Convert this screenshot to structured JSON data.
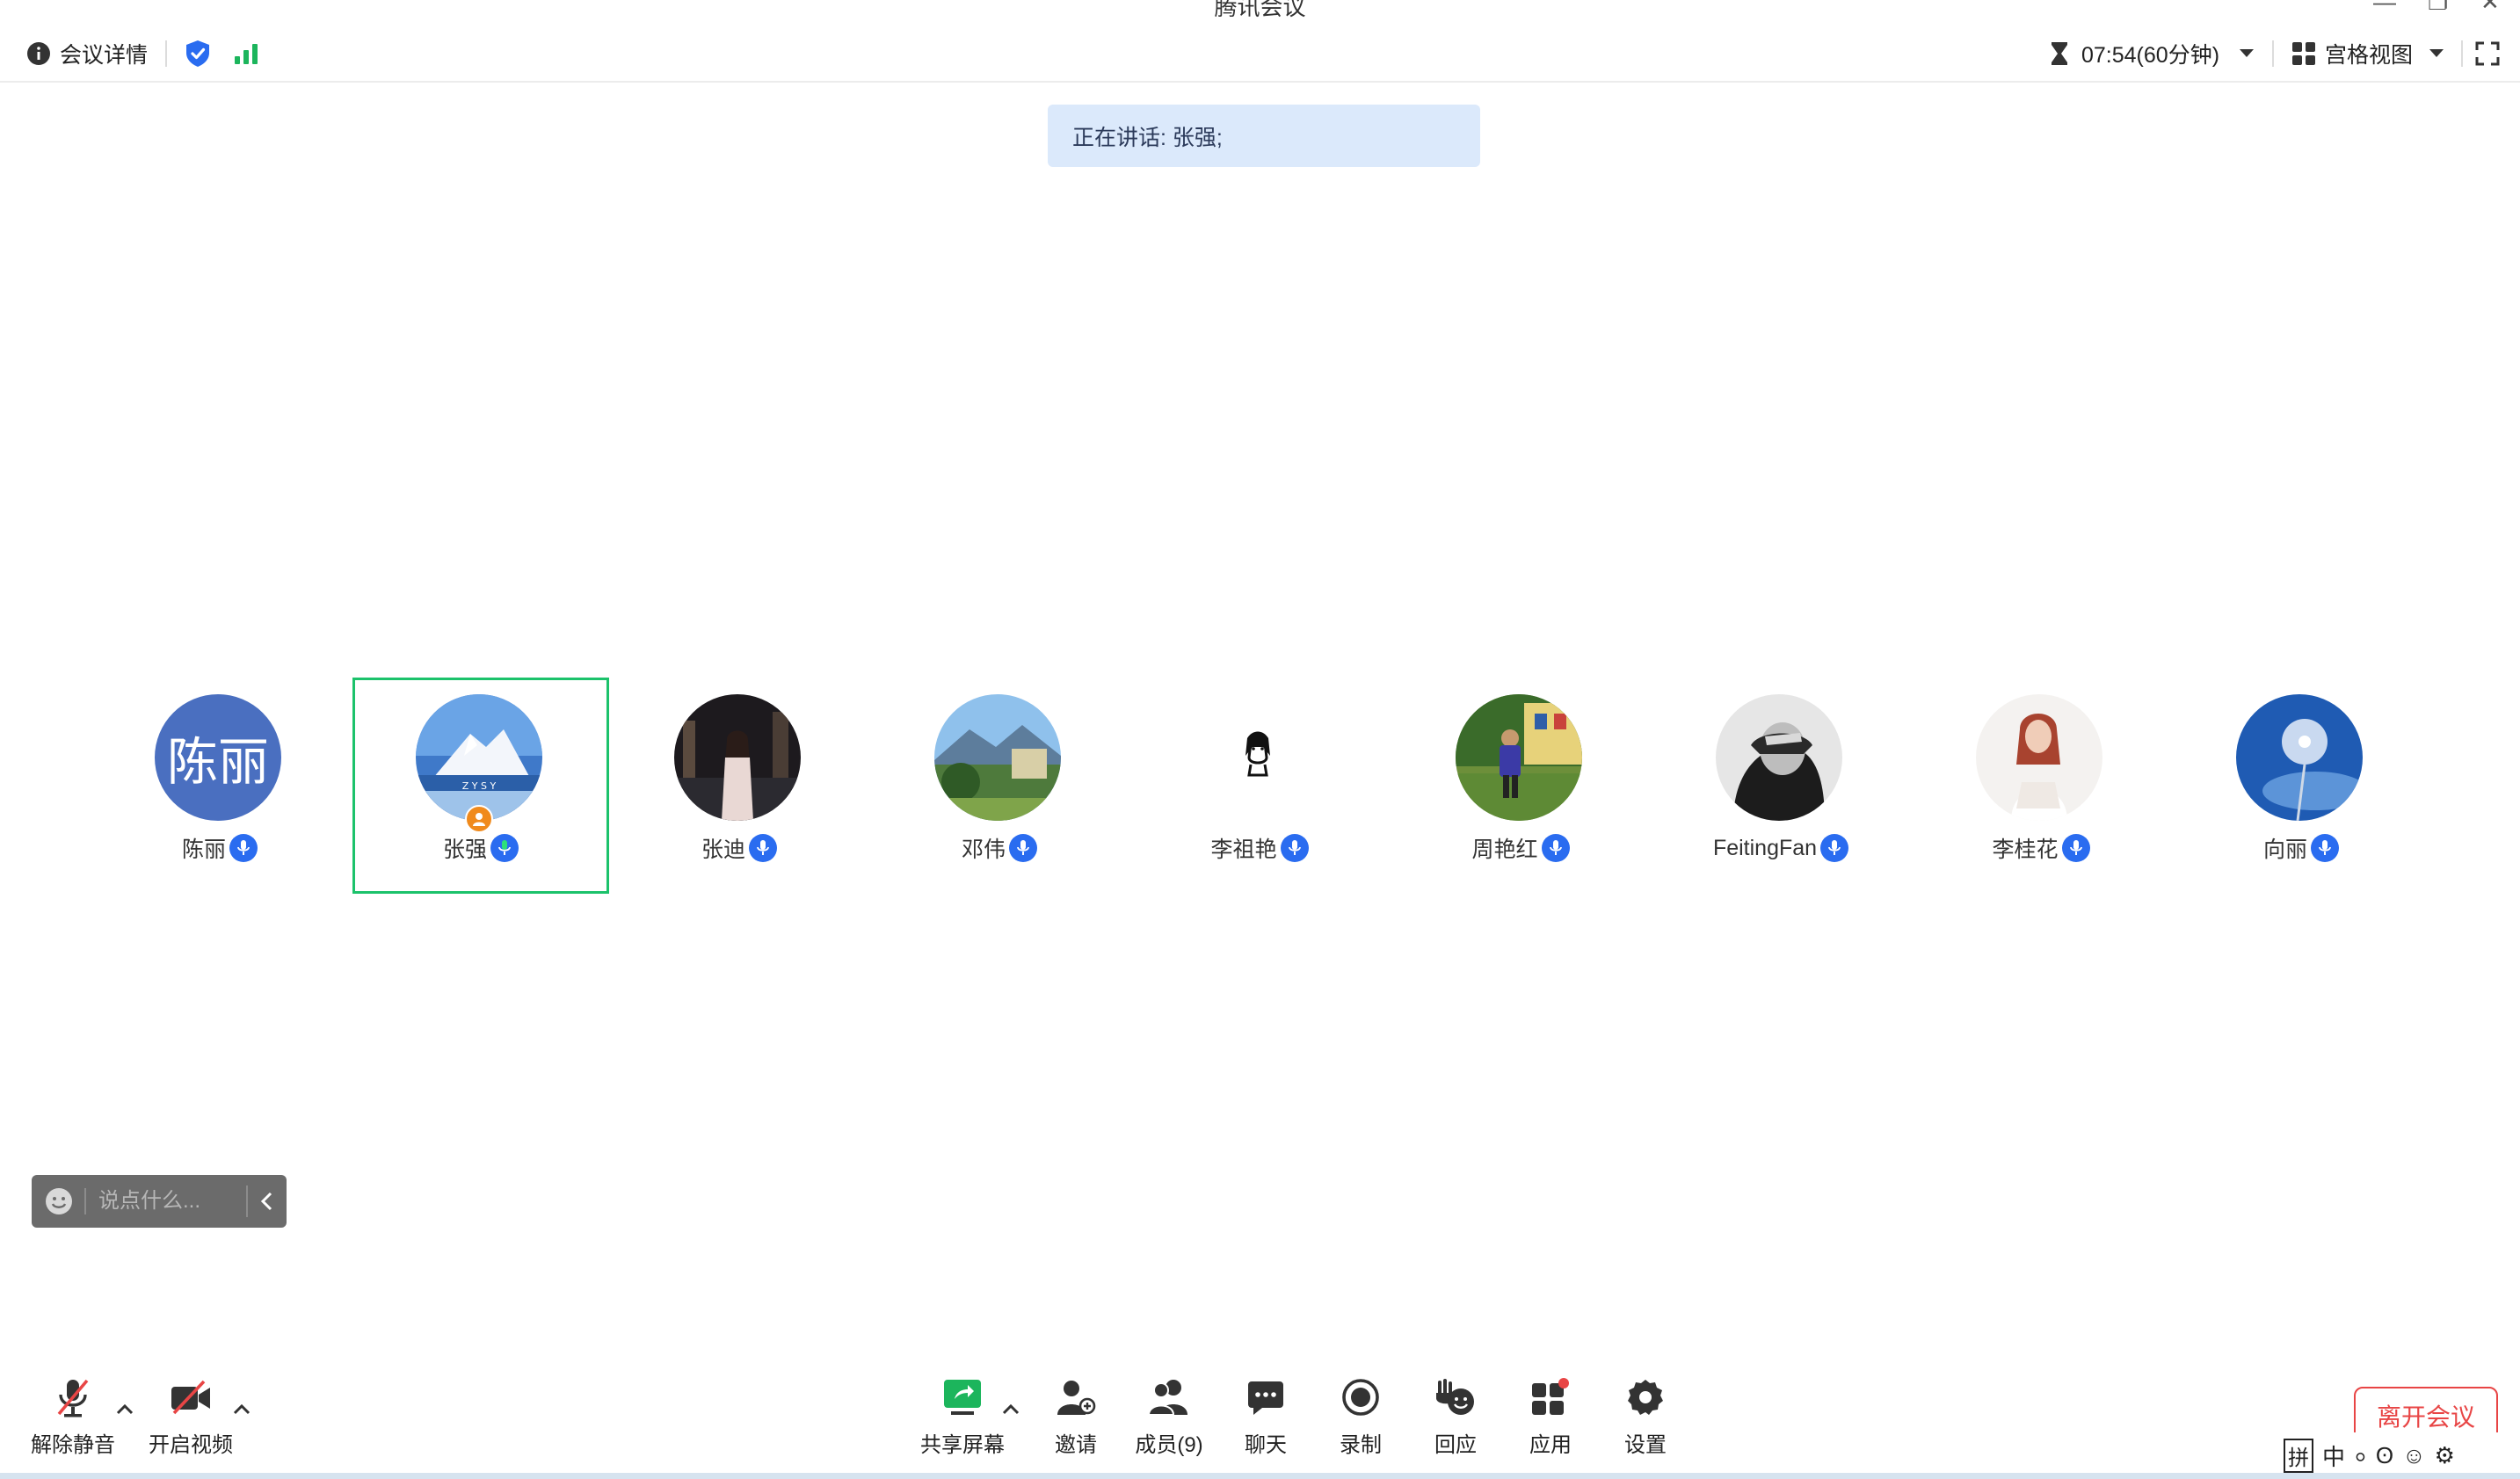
{
  "window": {
    "title": "腾讯会议",
    "controls": [
      "minimize-icon",
      "restore-icon",
      "close-icon"
    ]
  },
  "topbar": {
    "meeting_details_label": "会议详情",
    "security_icon": "shield-check-icon",
    "signal_icon": "signal-bars-icon",
    "timer": "07:54(60分钟)",
    "view_mode_label": "宫格视图",
    "fullscreen_icon": "fullscreen-icon"
  },
  "speaking": {
    "text": "正在讲话: 张强;"
  },
  "participants": [
    {
      "name": "陈丽",
      "avatar_text": "陈丽",
      "avatar_kind": "text",
      "avatar_color": "#4a6fc0"
    },
    {
      "name": "张强",
      "avatar_kind": "photo-mountain",
      "is_host": true,
      "active_speaker": true
    },
    {
      "name": "张迪",
      "avatar_kind": "photo-night-city"
    },
    {
      "name": "邓伟",
      "avatar_kind": "photo-landscape"
    },
    {
      "name": "李祖艳",
      "avatar_kind": "sketch"
    },
    {
      "name": "周艳红",
      "avatar_kind": "photo-child"
    },
    {
      "name": "FeitingFan",
      "avatar_kind": "photo-bw-portrait"
    },
    {
      "name": "李桂花",
      "avatar_kind": "photo-portrait-light"
    },
    {
      "name": "向丽",
      "avatar_kind": "photo-dandelion"
    }
  ],
  "chat": {
    "placeholder": "说点什么..."
  },
  "toolbar": {
    "unmute_label": "解除静音",
    "video_label": "开启视频",
    "share_label": "共享屏幕",
    "invite_label": "邀请",
    "members_label": "成员(9)",
    "chat_label": "聊天",
    "record_label": "录制",
    "reaction_label": "回应",
    "apps_label": "应用",
    "settings_label": "设置",
    "leave_label": "离开会议"
  },
  "ime": {
    "items": [
      "拼",
      "中",
      "⸰",
      "ʘ",
      "☺",
      "⚙"
    ]
  },
  "colors": {
    "accent_blue": "#2a6cf0",
    "active_green": "#1cc26b",
    "danger_red": "#e84545",
    "banner_bg": "#dbe9fb"
  }
}
